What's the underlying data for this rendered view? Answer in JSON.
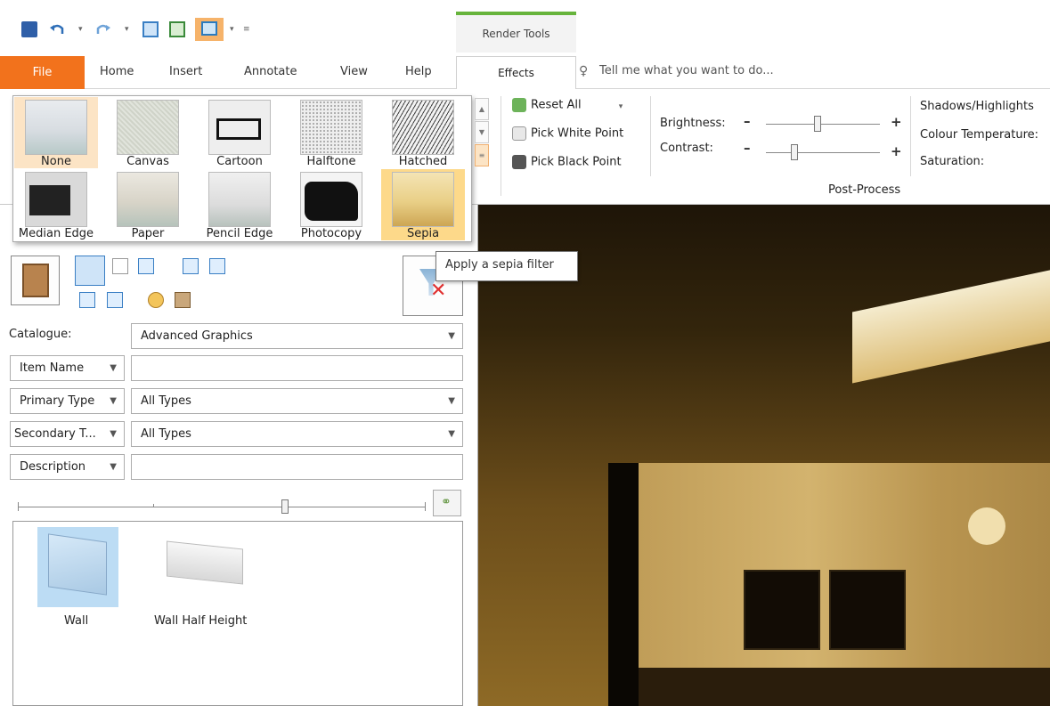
{
  "context_group": {
    "label": "Render Tools"
  },
  "tabs": {
    "file": "File",
    "home": "Home",
    "insert": "Insert",
    "annotate": "Annotate",
    "view": "View",
    "help": "Help",
    "effects": "Effects",
    "tell_me": "Tell me what you want to do..."
  },
  "gallery": {
    "items": [
      {
        "label": "None",
        "state": "selected"
      },
      {
        "label": "Canvas"
      },
      {
        "label": "Cartoon"
      },
      {
        "label": "Halftone"
      },
      {
        "label": "Hatched"
      },
      {
        "label": "Median Edge"
      },
      {
        "label": "Paper"
      },
      {
        "label": "Pencil Edge"
      },
      {
        "label": "Photocopy"
      },
      {
        "label": "Sepia",
        "state": "hover"
      }
    ]
  },
  "post_process": {
    "reset_all": "Reset All",
    "pick_white_point": "Pick White Point",
    "pick_black_point": "Pick Black Point",
    "brightness_label": "Brightness:",
    "contrast_label": "Contrast:",
    "brightness_level": 0.45,
    "contrast_level": 0.25,
    "shadows_highlights": "Shadows/Highlights",
    "colour_temperature": "Colour Temperature:",
    "saturation": "Saturation:",
    "group_label": "Post-Process",
    "minus": "–",
    "plus": "+"
  },
  "tooltip": {
    "text": "Apply a sepia filter"
  },
  "catalogue": {
    "label": "Catalogue:",
    "value": "Advanced Graphics",
    "filters": [
      {
        "selector": "Item Name",
        "value": ""
      },
      {
        "selector": "Primary Type",
        "value": "All Types"
      },
      {
        "selector": "Secondary T...",
        "value": "All Types"
      },
      {
        "selector": "Description",
        "value": ""
      }
    ],
    "items": [
      {
        "label": "Wall",
        "selected": true
      },
      {
        "label": "Wall Half Height"
      }
    ]
  },
  "colors": {
    "file_tab": "#f2721c",
    "context_accent": "#67b43c",
    "gallery_selected": "#fce4c5",
    "gallery_hover": "#fdd98a",
    "selection_blue": "#bcdcf4"
  }
}
